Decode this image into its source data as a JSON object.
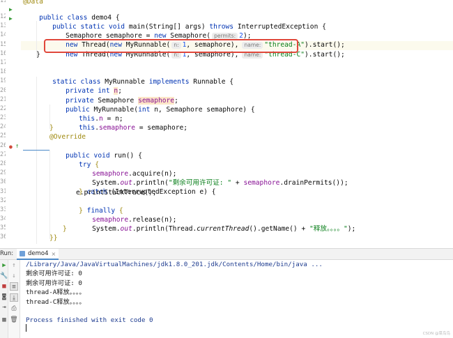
{
  "editor": {
    "line_numbers": [
      "11",
      "12",
      "13",
      "14",
      "15",
      "16",
      "17",
      "18",
      "19",
      "20",
      "21",
      "22",
      "23",
      "24",
      "25",
      "26",
      "27",
      "28",
      "29",
      "30",
      "31",
      "32",
      "33",
      "34",
      "35",
      "36"
    ],
    "top_fragment": "@Data",
    "class_decl": {
      "kw": "public class ",
      "name": "demo4 {"
    },
    "main_sig": {
      "kw1": "public static void ",
      "name": "main(String[] args) ",
      "kw2": "throws ",
      "rest": "InterruptedException {"
    },
    "sem_line": {
      "a": "Semaphore semaphore = ",
      "kw": "new ",
      "b": "Semaphore(",
      "hint": "permits:",
      "num": "2",
      "c": ");"
    },
    "thread_a": {
      "a": "new ",
      "b": "Thread(",
      "c": "new ",
      "d": "MyRunnable(",
      "hint_n": "n:",
      "num": "1",
      "e": ", semaphore),",
      "hint_name": "name:",
      "str": "\"thread-A\"",
      "f": ").start();"
    },
    "thread_c": {
      "a": "new ",
      "b": "Thread(",
      "c": "new ",
      "d": "MyRunnable(",
      "hint_n": "n:",
      "num": "1",
      "e": ", semaphore),",
      "hint_name": "name:",
      "str": "\"thread-C\"",
      "f": ").start();"
    },
    "close_main": "}",
    "inner_class": {
      "kw": "static class ",
      "name": "MyRunnable ",
      "kw2": "implements ",
      "rest": "Runnable {"
    },
    "field_n": {
      "kw": "private int ",
      "fld": "n",
      "rest": ";"
    },
    "field_sem": {
      "kw": "private ",
      "type": "Semaphore ",
      "fld": "semaphore",
      "rest": ";"
    },
    "ctor": {
      "kw": "public ",
      "name": "MyRunnable(",
      "kw2": "int ",
      "rest": "n, Semaphore semaphore) {"
    },
    "ctor_b1": {
      "kw": "this",
      "dot": ".",
      "fld": "n",
      "rest": " = n;"
    },
    "ctor_b2": {
      "kw": "this",
      "dot": ".",
      "fld": "semaphore",
      "rest": " = semaphore;"
    },
    "ctor_close": "}",
    "override": "@Override",
    "run_sig": {
      "kw": "public void ",
      "name": "run() {"
    },
    "try_line": {
      "kw": "try ",
      "rest": "{"
    },
    "acquire": {
      "fld": "semaphore",
      "rest": ".acquire(n);"
    },
    "print1": {
      "a": "System.",
      "out": "out",
      "b": ".println(",
      "str": "\"剩余可用许可证: \"",
      "c": " + ",
      "fld": "semaphore",
      "d": ".drainPermits());"
    },
    "catch_line": {
      "a": "} ",
      "kw": "catch ",
      "rest": "(InterruptedException e) {"
    },
    "stack": "e.printStackTrace();",
    "finally_line": {
      "a": "} ",
      "kw": "finally ",
      "rest": "{"
    },
    "release": {
      "fld": "semaphore",
      "rest": ".release(n);"
    },
    "print2": {
      "a": "System.",
      "out": "out",
      "b": ".println(Thread.",
      "it": "currentThread",
      "c": "().getName() + ",
      "str": "\"释放。。。。\"",
      "d": ");"
    },
    "close1": "}",
    "close2": "}}"
  },
  "run_panel": {
    "label": "Run:",
    "tab": "demo4",
    "tab_close": "×",
    "output": [
      "/Library/Java/JavaVirtualMachines/jdk1.8.0_201.jdk/Contents/Home/bin/java ...",
      "剩余可用许可证: 0",
      "剩余可用许可证: 0",
      "thread-A释放。。。。",
      "thread-C释放。。。。",
      "",
      "Process finished with exit code 0"
    ],
    "watermark": "CSDN @菜鸟鸟"
  },
  "colors": {
    "keyword": "#0033b3",
    "field": "#871094",
    "string": "#067d17",
    "number": "#1750eb",
    "annotation": "#9e880d",
    "highlight_box": "#e0473a"
  }
}
